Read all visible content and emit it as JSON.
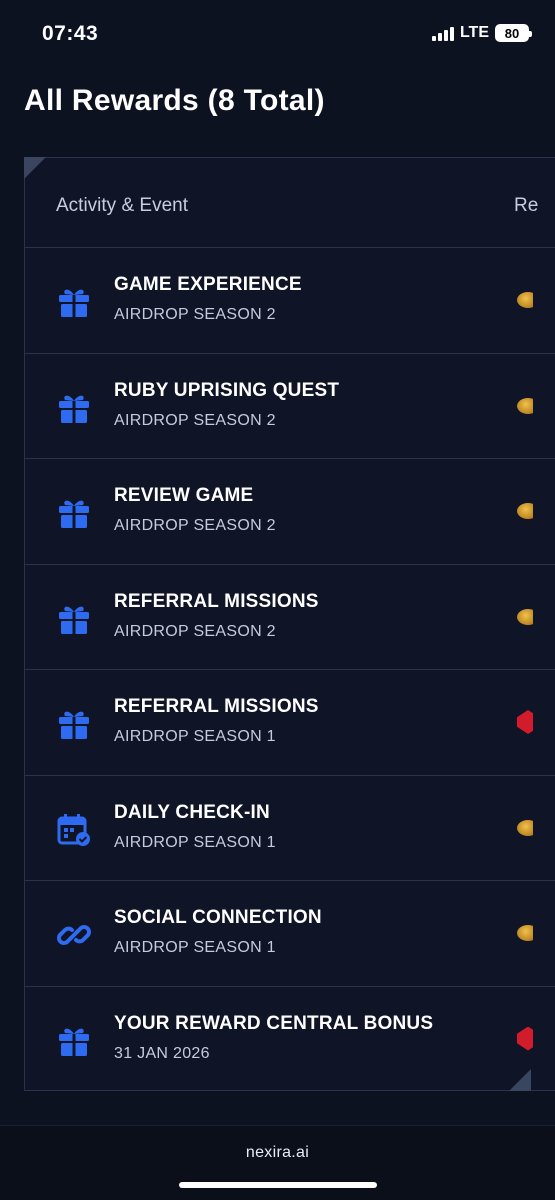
{
  "status": {
    "time": "07:43",
    "network": "LTE",
    "battery": "80"
  },
  "page": {
    "title": "All Rewards (8 Total)"
  },
  "table": {
    "col_activity": "Activity & Event",
    "col_reward": "Re"
  },
  "rewards": [
    {
      "title": "GAME EXPERIENCE",
      "subtitle": "AIRDROP SEASON 2",
      "icon": "gift-icon",
      "reward_type": "coin"
    },
    {
      "title": "RUBY UPRISING QUEST",
      "subtitle": "AIRDROP SEASON 2",
      "icon": "gift-icon",
      "reward_type": "coin"
    },
    {
      "title": "REVIEW GAME",
      "subtitle": "AIRDROP SEASON 2",
      "icon": "gift-icon",
      "reward_type": "coin"
    },
    {
      "title": "REFERRAL MISSIONS",
      "subtitle": "AIRDROP SEASON 2",
      "icon": "gift-icon",
      "reward_type": "coin"
    },
    {
      "title": "REFERRAL MISSIONS",
      "subtitle": "AIRDROP SEASON 1",
      "icon": "gift-icon",
      "reward_type": "ruby"
    },
    {
      "title": "DAILY CHECK-IN",
      "subtitle": "AIRDROP SEASON 1",
      "icon": "calendar-check-icon",
      "reward_type": "coin"
    },
    {
      "title": "SOCIAL CONNECTION",
      "subtitle": "AIRDROP SEASON 1",
      "icon": "link-icon",
      "reward_type": "coin"
    },
    {
      "title": "YOUR REWARD CENTRAL BONUS",
      "subtitle": "31 JAN 2026",
      "icon": "gift-icon",
      "reward_type": "ruby"
    }
  ],
  "footer": {
    "domain": "nexira.ai"
  },
  "colors": {
    "background": "#0d1220",
    "accent_icon": "#2f6bf0",
    "coin": "#e0a62c",
    "ruby": "#d21b2b"
  }
}
